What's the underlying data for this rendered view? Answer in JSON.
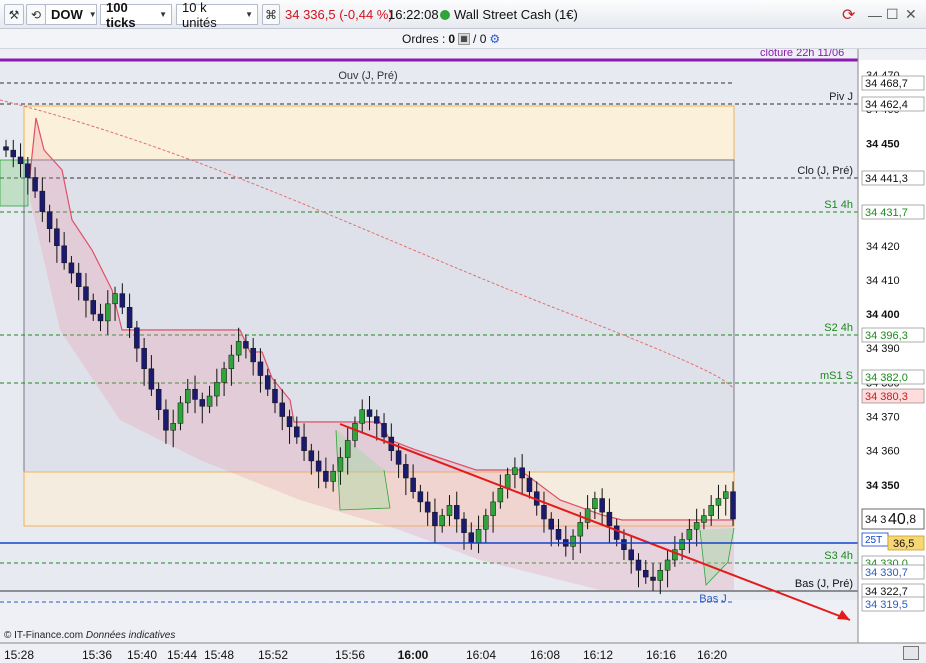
{
  "toolbar": {
    "symbol": "DOW",
    "ticks": "100 ticks",
    "units": "10 k unités",
    "change": "34 336,5 (-0,44 %)",
    "time": "16:22:08",
    "instrument": "Wall Street Cash (1€)",
    "icons": [
      "hammer-icon",
      "history-icon",
      "magnet-icon",
      "square-icon",
      "refresh-icon",
      "minimize-icon",
      "maximize-icon",
      "close-icon"
    ]
  },
  "orders": {
    "label": "Ordres :",
    "count_left": "0",
    "count_right": "/ 0"
  },
  "top_label": "clôture 22h 11/06",
  "footer": {
    "source": "© IT-Finance.com",
    "note": "Données indicatives"
  },
  "colors": {
    "up_candle": "#2ea43a",
    "down_candle": "#1a1a6e",
    "trend": "#e31b1b",
    "envelope": "#e0455a",
    "ma": "#e07070",
    "price_line": "#1144cc",
    "pivot_purple": "#8a1bb0"
  },
  "levels": {
    "ouv_label": "Ouv (J, Pré)",
    "piv_label": "Piv J",
    "piv_value": "34 462,4",
    "ouv_value": "34 468,7",
    "clo_label": "Clo (J, Pré)",
    "clo_value": "34 441,3",
    "s1_label": "S1 4h",
    "s1_value": "34 431,7",
    "s2_label": "S2 4h",
    "s2_value": "34 396,3",
    "ms1_label": "mS1 S",
    "ms1_value": "34 382,0",
    "ma_value": "34 380,3",
    "price_value": "34 340,8",
    "price_main": "34 3",
    "price_big": "40",
    "price_small": ",8",
    "tag_25t": "25T",
    "tag_25t_val": "36,5",
    "s3_label": "S3 4h",
    "s3_value": "34 330,0",
    "s3b_value": "34 330,7",
    "bas_label": "Bas (J, Pré)",
    "bas_value": "34 322,7",
    "basj_label": "Bas J",
    "basj_value": "34 319,5"
  },
  "chart_data": {
    "type": "candlestick",
    "x_tick_labels": [
      "15:28",
      "15:36",
      "15:40",
      "15:44",
      "15:48",
      "15:52",
      "15:56",
      "16:00",
      "16:04",
      "16:08",
      "16:12",
      "16:16",
      "16:20"
    ],
    "y_tick_labels": [
      "34 470",
      "34 460",
      "34 450",
      "34 440",
      "34 430",
      "34 420",
      "34 410",
      "34 400",
      "34 390",
      "34 380",
      "34 370",
      "34 360",
      "34 350",
      "34 340"
    ],
    "y_range": [
      34313,
      34478
    ],
    "grid": false,
    "candles_close": [
      34448,
      34446,
      34444,
      34440,
      34436,
      34430,
      34425,
      34420,
      34415,
      34412,
      34408,
      34404,
      34400,
      34398,
      34403,
      34406,
      34402,
      34396,
      34390,
      34384,
      34378,
      34372,
      34366,
      34368,
      34374,
      34378,
      34375,
      34373,
      34376,
      34380,
      34384,
      34388,
      34392,
      34390,
      34386,
      34382,
      34378,
      34374,
      34370,
      34367,
      34364,
      34360,
      34357,
      34354,
      34351,
      34354,
      34358,
      34363,
      34368,
      34372,
      34370,
      34368,
      34364,
      34360,
      34356,
      34352,
      34348,
      34345,
      34342,
      34338,
      34341,
      34344,
      34340,
      34336,
      34333,
      34337,
      34341,
      34345,
      34349,
      34353,
      34355,
      34352,
      34348,
      34344,
      34340,
      34337,
      34334,
      34332,
      34335,
      34339,
      34343,
      34346,
      34342,
      34338,
      34334,
      34331,
      34328,
      34325,
      34323,
      34322,
      34325,
      34328,
      34331,
      34334,
      34337,
      34339,
      34341,
      34344,
      34346,
      34348,
      34340
    ]
  }
}
